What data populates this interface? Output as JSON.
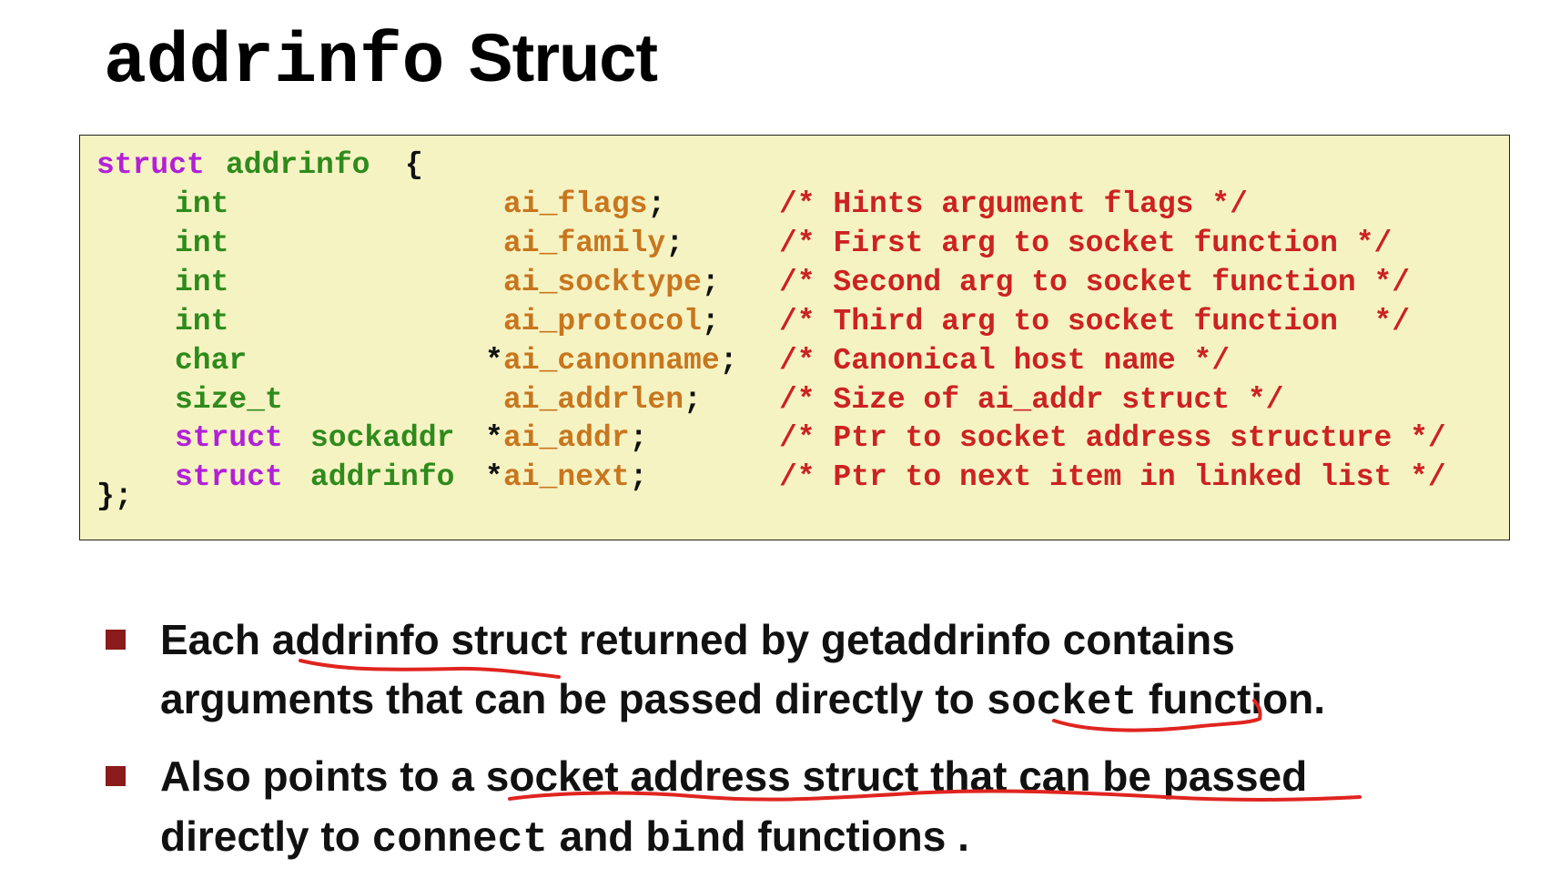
{
  "slide": {
    "title_code": "addrinfo",
    "title_text": "Struct"
  },
  "code": {
    "open": {
      "kw": "struct",
      "ty": "addrinfo",
      "brace": "{"
    },
    "members": [
      {
        "type_kw": "",
        "type": "int",
        "star": "",
        "field": "ai_flags",
        "semi": ";",
        "comment": "/* Hints argument flags */"
      },
      {
        "type_kw": "",
        "type": "int",
        "star": "",
        "field": "ai_family",
        "semi": ";",
        "comment": "/* First arg to socket function */"
      },
      {
        "type_kw": "",
        "type": "int",
        "star": "",
        "field": "ai_socktype",
        "semi": ";",
        "comment": "/* Second arg to socket function */"
      },
      {
        "type_kw": "",
        "type": "int",
        "star": "",
        "field": "ai_protocol",
        "semi": ";",
        "comment": "/* Third arg to socket function  */"
      },
      {
        "type_kw": "",
        "type": "char",
        "star": "*",
        "field": "ai_canonname",
        "semi": ";",
        "comment": "/* Canonical host name */"
      },
      {
        "type_kw": "",
        "type": "size_t",
        "star": "",
        "field": "ai_addrlen",
        "semi": ";",
        "comment": "/* Size of ai_addr struct */"
      },
      {
        "type_kw": "struct",
        "type": "sockaddr",
        "star": "*",
        "field": "ai_addr",
        "semi": ";",
        "comment": "/* Ptr to socket address structure */"
      },
      {
        "type_kw": "struct",
        "type": "addrinfo",
        "star": "*",
        "field": "ai_next",
        "semi": ";",
        "comment": "/* Ptr to next item in linked list */"
      }
    ],
    "close": "};"
  },
  "bullets": [
    {
      "line1": {
        "a": "Each ",
        "b": "addrinfo struct",
        "c": " returned by getaddrinfo contains"
      },
      "line2": {
        "a": "arguments that can be passed directly to ",
        "code": "socket",
        "c": " function."
      }
    },
    {
      "line1": {
        "a": "Also points to a ",
        "b": "socket address struct that can be passed"
      },
      "line2": {
        "a": "directly to ",
        "code1": "connect",
        "mid": " and ",
        "code2": "bind",
        "c": "  functions ."
      }
    }
  ],
  "colors": {
    "keyword": "#b220d8",
    "type": "#2e8b1c",
    "field": "#c8761e",
    "comment": "#cc2222",
    "code_bg": "#f6f3c3",
    "bullet": "#8b1a1a",
    "annotation": "#e0241f"
  }
}
